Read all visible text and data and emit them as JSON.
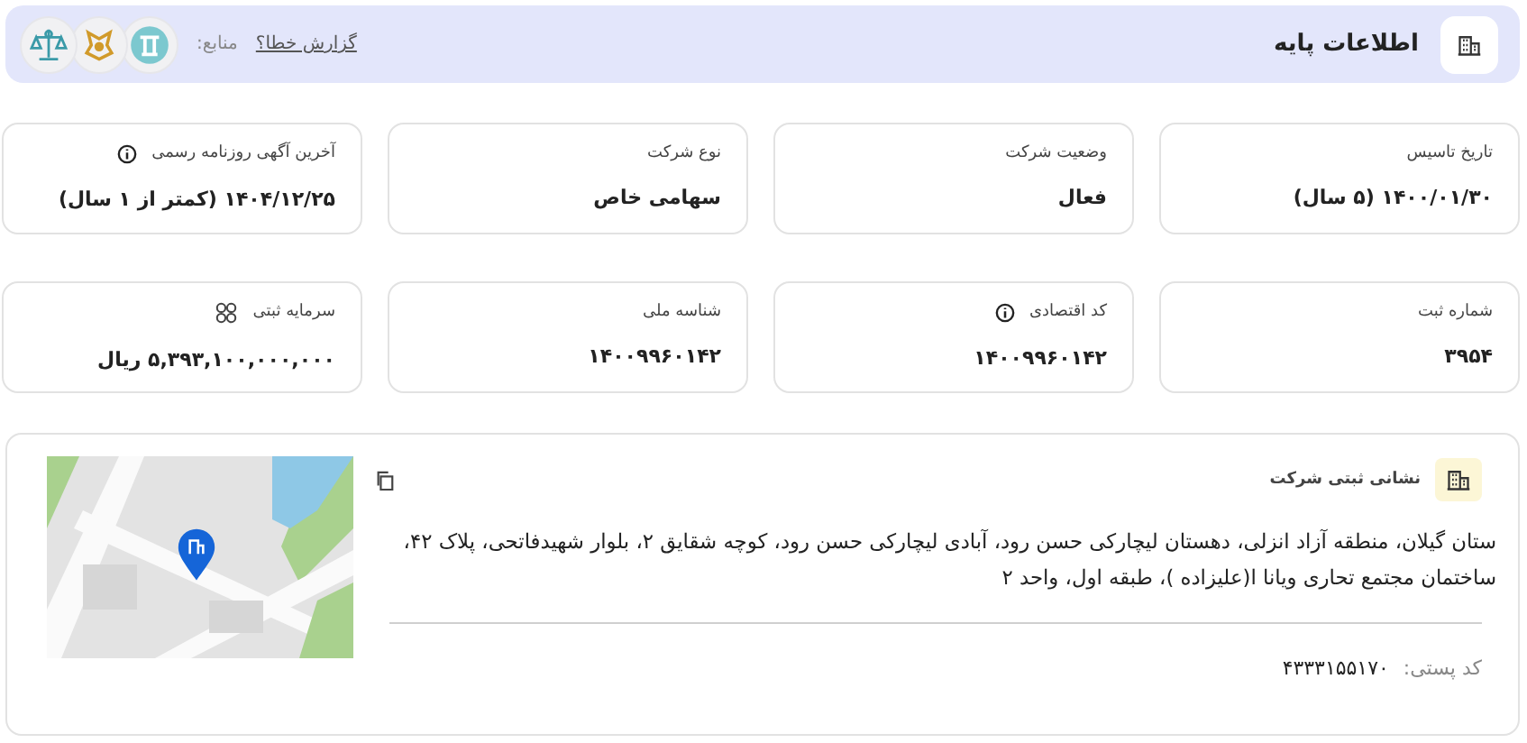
{
  "header": {
    "title": "اطلاعات پایه",
    "report_link": "گزارش خطا؟",
    "sources_label": "منابع:"
  },
  "cards": [
    {
      "kind": "plain",
      "label": "تاریخ تاسیس",
      "value": "۱۴۰۰/۰۱/۳۰ (۵ سال)"
    },
    {
      "kind": "plain",
      "label": "وضعیت شرکت",
      "value": "فعال"
    },
    {
      "kind": "plain",
      "label": "نوع شرکت",
      "value": "سهامی خاص"
    },
    {
      "kind": "info",
      "label": "آخرین آگهی روزنامه رسمی",
      "value": "۱۴۰۴/۱۲/۲۵ (کمتر از ۱ سال)"
    },
    {
      "kind": "plain",
      "label": "شماره ثبت",
      "value": "۳۹۵۴"
    },
    {
      "kind": "info",
      "label": "کد اقتصادی",
      "value": "۱۴۰۰۹۹۶۰۱۴۲"
    },
    {
      "kind": "plain",
      "label": "شناسه ملی",
      "value": "۱۴۰۰۹۹۶۰۱۴۲"
    },
    {
      "kind": "capital",
      "label": "سرمایه ثبتی",
      "value": "۵,۳۹۳,۱۰۰,۰۰۰,۰۰۰ ریال"
    }
  ],
  "address": {
    "title": "نشانی ثبتی شرکت",
    "text": "ستان گیلان، منطقه آزاد انزلی، دهستان لیچارکی حسن رود، آبادی لیچارکی حسن رود، کوچه شقایق ۲، بلوار شهیدفاتحی، پلاک ۴۲، ساختمان مجتمع تحاری ویانا ا(علیزاده )، طبقه اول، واحد ۲",
    "postal_label": "کد پستی:",
    "postal_code": "۴۳۳۳۱۵۵۱۷۰"
  }
}
